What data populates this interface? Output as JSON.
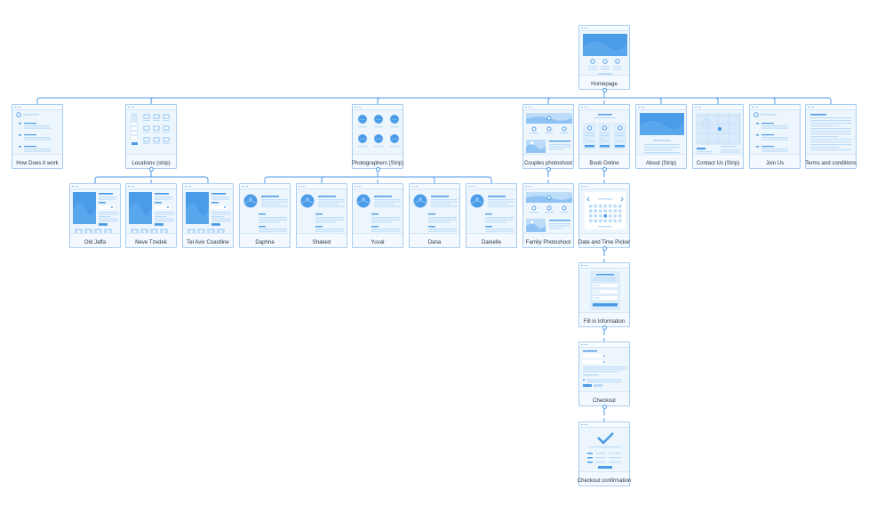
{
  "nodes": [
    {
      "id": "homepage",
      "label": "Homepage",
      "kind": "hero3"
    },
    {
      "id": "how",
      "label": "How Does it work",
      "kind": "steps"
    },
    {
      "id": "locations",
      "label": "Locations (strip)",
      "kind": "grid"
    },
    {
      "id": "photographers",
      "label": "Photographers (Strip)",
      "kind": "circles"
    },
    {
      "id": "couples",
      "label": "Couples photoshoot",
      "kind": "collage"
    },
    {
      "id": "book",
      "label": "Book Online",
      "kind": "cards3"
    },
    {
      "id": "about",
      "label": "About (Strip)",
      "kind": "about"
    },
    {
      "id": "contact",
      "label": "Contact Us (Strip)",
      "kind": "map"
    },
    {
      "id": "join",
      "label": "Join Us",
      "kind": "steps"
    },
    {
      "id": "terms",
      "label": "Terms and conditions",
      "kind": "text"
    },
    {
      "id": "jaffa",
      "label": "Old Jaffa",
      "kind": "location"
    },
    {
      "id": "neve",
      "label": "Neve Tzedek",
      "kind": "location"
    },
    {
      "id": "coast",
      "label": "Tel Aviv Coastline",
      "kind": "location"
    },
    {
      "id": "daphna",
      "label": "Daphna",
      "kind": "profile"
    },
    {
      "id": "shaked",
      "label": "Shaked",
      "kind": "profile"
    },
    {
      "id": "yuval",
      "label": "Yuval",
      "kind": "profile"
    },
    {
      "id": "dana",
      "label": "Dana",
      "kind": "profile"
    },
    {
      "id": "danielle",
      "label": "Danielle",
      "kind": "profile"
    },
    {
      "id": "family",
      "label": "Family Photoshoot",
      "kind": "collage"
    },
    {
      "id": "datetime",
      "label": "Date and Time Picker",
      "kind": "calendar"
    },
    {
      "id": "fill",
      "label": "Fill in Information",
      "kind": "form"
    },
    {
      "id": "checkout",
      "label": "Checkout",
      "kind": "checkout"
    },
    {
      "id": "confirm",
      "label": "Checkout confirmation",
      "kind": "confirm"
    }
  ],
  "edges": [
    [
      "homepage",
      "how"
    ],
    [
      "homepage",
      "locations"
    ],
    [
      "homepage",
      "photographers"
    ],
    [
      "homepage",
      "couples"
    ],
    [
      "homepage",
      "book"
    ],
    [
      "homepage",
      "about"
    ],
    [
      "homepage",
      "contact"
    ],
    [
      "homepage",
      "join"
    ],
    [
      "homepage",
      "terms"
    ],
    [
      "locations",
      "jaffa"
    ],
    [
      "locations",
      "neve"
    ],
    [
      "locations",
      "coast"
    ],
    [
      "photographers",
      "daphna"
    ],
    [
      "photographers",
      "shaked"
    ],
    [
      "photographers",
      "yuval"
    ],
    [
      "photographers",
      "dana"
    ],
    [
      "photographers",
      "danielle"
    ],
    [
      "couples",
      "family"
    ],
    [
      "book",
      "datetime"
    ],
    [
      "datetime",
      "fill"
    ],
    [
      "fill",
      "checkout"
    ],
    [
      "checkout",
      "confirm"
    ]
  ],
  "colors": {
    "line": "#4c9ae8",
    "accent": "#4a9be8",
    "light": "#bcdcf8",
    "pale": "#d8eafb",
    "frame": "#a9cdf2"
  }
}
